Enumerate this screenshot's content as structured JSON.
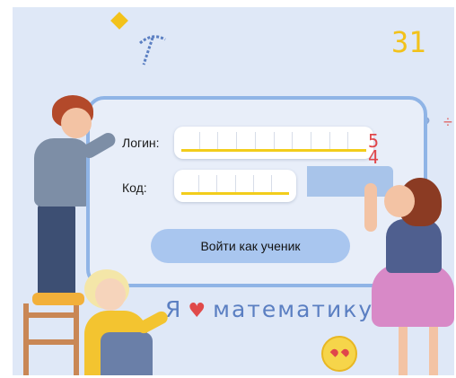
{
  "form": {
    "login_label": "Логин:",
    "code_label": "Код:",
    "login_cells": 10,
    "code_cells": 6,
    "submit_label": "Войти как ученик"
  },
  "decor": {
    "caption_left": "Я",
    "caption_right": "математику",
    "digits_top": "31",
    "digits_red": "5\n4",
    "equation": "=?",
    "divide": "÷"
  },
  "colors": {
    "background": "#dfe8f7",
    "board_border": "#8fb4e6",
    "button": "#a9c6ef",
    "underline": "#f2cd1b",
    "caption": "#5b7fc2",
    "heart": "#e04a4a"
  }
}
